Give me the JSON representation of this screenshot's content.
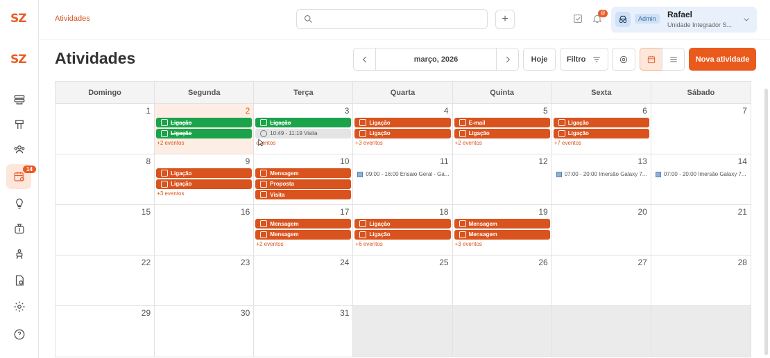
{
  "app": {
    "logo": "SZ",
    "breadcrumb": "Atividades",
    "notif_count": "@"
  },
  "sidebar": {
    "badge": "14"
  },
  "user": {
    "role": "Admin",
    "name": "Rafael",
    "unit": "Unidade Integrador S..."
  },
  "page": {
    "title": "Atividades"
  },
  "toolbar": {
    "month": "março, 2026",
    "today": "Hoje",
    "filter": "Filtro",
    "new": "Nova atividade"
  },
  "weekdays": [
    "Domingo",
    "Segunda",
    "Terça",
    "Quarta",
    "Quinta",
    "Sexta",
    "Sábado"
  ],
  "weeks": [
    {
      "days": [
        {
          "n": "1",
          "evs": []
        },
        {
          "n": "2",
          "today": true,
          "evs": [
            {
              "t": "Ligação",
              "c": "g",
              "done": true
            },
            {
              "t": "Ligação",
              "c": "g",
              "done": true
            }
          ],
          "more": "+2 eventos"
        },
        {
          "n": "3",
          "evs": [
            {
              "t": "Ligação",
              "c": "g",
              "done": true
            },
            {
              "t": "10:49 - 11:19 Visita",
              "c": "grey"
            }
          ],
          "more": "eventos"
        },
        {
          "n": "4",
          "evs": [
            {
              "t": "Ligação",
              "c": "o"
            },
            {
              "t": "Ligação",
              "c": "o"
            }
          ],
          "more": "+3 eventos"
        },
        {
          "n": "5",
          "evs": [
            {
              "t": "E-mail",
              "c": "o"
            },
            {
              "t": "Ligação",
              "c": "o"
            }
          ],
          "more": "+2 eventos"
        },
        {
          "n": "6",
          "evs": [
            {
              "t": "Ligação",
              "c": "o"
            },
            {
              "t": "Ligação",
              "c": "o"
            }
          ],
          "more": "+7 eventos"
        },
        {
          "n": "7",
          "evs": []
        }
      ]
    },
    {
      "days": [
        {
          "n": "8",
          "evs": []
        },
        {
          "n": "9",
          "evs": [
            {
              "t": "Ligação",
              "c": "o"
            },
            {
              "t": "Ligação",
              "c": "o"
            }
          ],
          "more": "+3 eventos"
        },
        {
          "n": "10",
          "evs": [
            {
              "t": "Mensagem",
              "c": "o"
            },
            {
              "t": "Proposta",
              "c": "o"
            },
            {
              "t": "Visita",
              "c": "o"
            }
          ]
        },
        {
          "n": "11",
          "evs": [],
          "allday": "09:00 - 16:00 Ensaio Geral - Ga..."
        },
        {
          "n": "12",
          "evs": []
        },
        {
          "n": "13",
          "evs": [],
          "allday": "07:00 - 20:00 Imersão Galaxy 7..."
        },
        {
          "n": "14",
          "evs": [],
          "allday": "07:00 - 20:00 Imersão Galaxy 7..."
        }
      ]
    },
    {
      "days": [
        {
          "n": "15",
          "evs": []
        },
        {
          "n": "16",
          "evs": []
        },
        {
          "n": "17",
          "evs": [
            {
              "t": "Mensagem",
              "c": "o"
            },
            {
              "t": "Mensagem",
              "c": "o"
            }
          ],
          "more": "+2 eventos"
        },
        {
          "n": "18",
          "evs": [
            {
              "t": "Ligação",
              "c": "o"
            },
            {
              "t": "Ligação",
              "c": "o"
            }
          ],
          "more": "+6 eventos"
        },
        {
          "n": "19",
          "evs": [
            {
              "t": "Mensagem",
              "c": "o"
            },
            {
              "t": "Mensagem",
              "c": "o"
            }
          ],
          "more": "+3 eventos"
        },
        {
          "n": "20",
          "evs": []
        },
        {
          "n": "21",
          "evs": []
        }
      ]
    },
    {
      "days": [
        {
          "n": "22",
          "evs": []
        },
        {
          "n": "23",
          "evs": []
        },
        {
          "n": "24",
          "evs": []
        },
        {
          "n": "25",
          "evs": []
        },
        {
          "n": "26",
          "evs": []
        },
        {
          "n": "27",
          "evs": []
        },
        {
          "n": "28",
          "evs": []
        }
      ]
    },
    {
      "days": [
        {
          "n": "29",
          "evs": []
        },
        {
          "n": "30",
          "evs": []
        },
        {
          "n": "31",
          "evs": []
        },
        {
          "n": "",
          "other": true,
          "evs": []
        },
        {
          "n": "",
          "other": true,
          "evs": []
        },
        {
          "n": "",
          "other": true,
          "evs": []
        },
        {
          "n": "",
          "other": true,
          "evs": []
        }
      ]
    }
  ]
}
